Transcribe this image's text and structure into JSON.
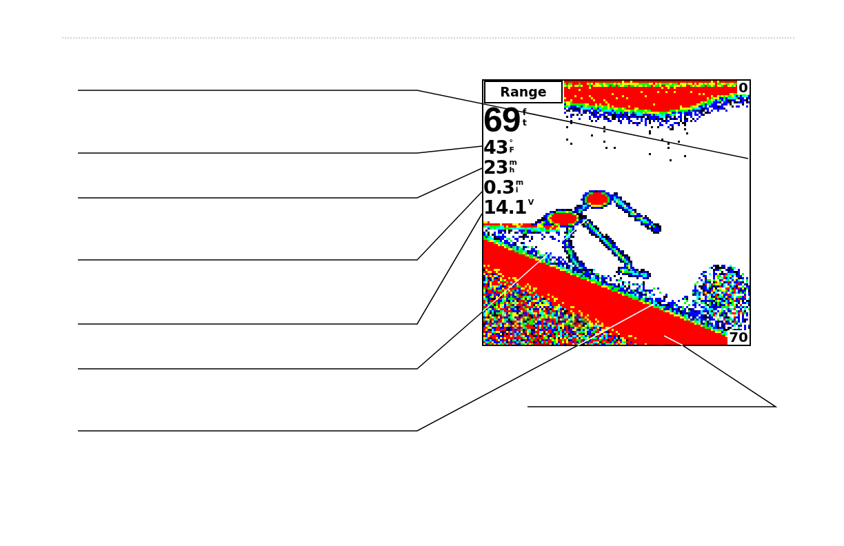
{
  "sonar_screen": {
    "range_label": "Range",
    "top_depth": "0",
    "readouts": [
      {
        "kind": "large",
        "value": "69",
        "unit": "ft"
      },
      {
        "kind": "small",
        "value": "43",
        "unit": "°F"
      },
      {
        "kind": "small",
        "value": "23",
        "unit": "mh"
      },
      {
        "kind": "small",
        "value": "0.3",
        "unit": "mi"
      },
      {
        "kind": "small",
        "value": "14.1",
        "unit": "V"
      }
    ],
    "bottom_depth": "70"
  }
}
